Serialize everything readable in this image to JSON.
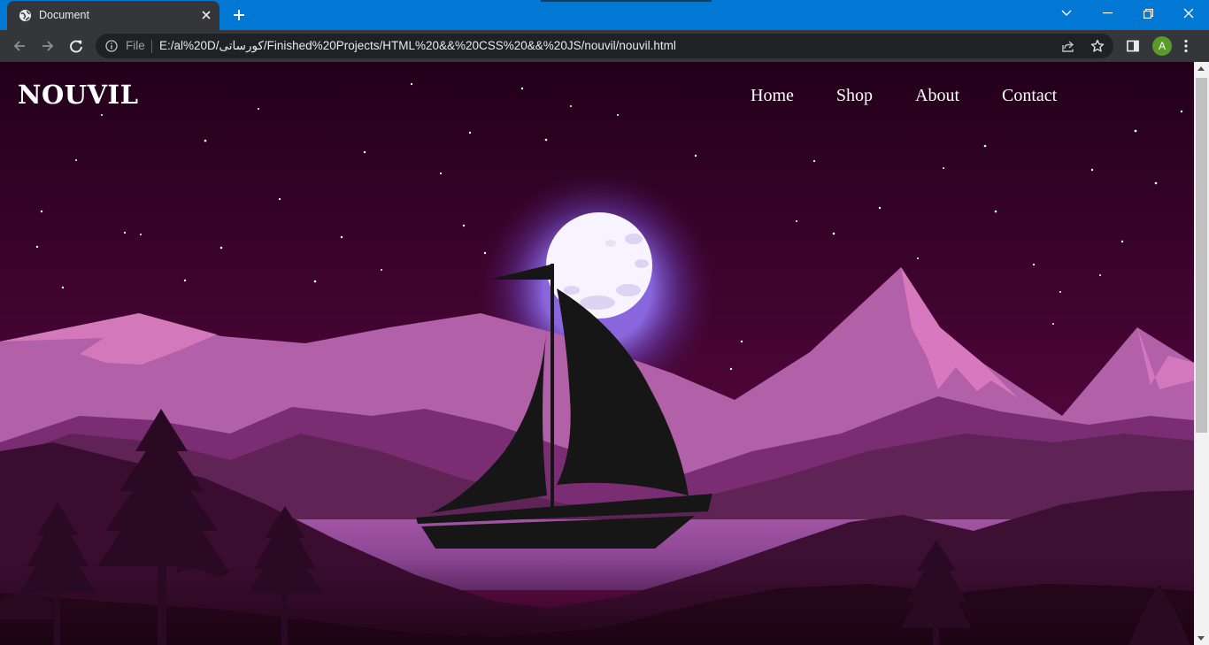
{
  "browser": {
    "tab": {
      "title": "Document",
      "icon": "globe-icon"
    },
    "controls": {
      "tab_search_icon": "chevron-down-icon",
      "minimize_icon": "minimize-icon",
      "restore_icon": "restore-icon",
      "close_icon": "close-icon"
    },
    "address": {
      "scheme_label": "File",
      "url": "E:/al%20D/کورساتی/Finished%20Projects/HTML%20&&%20CSS%20&&%20JS/nouvil/nouvil.html"
    },
    "profile_initial": "A",
    "accent_color": "#0078d4"
  },
  "page": {
    "brand": "NOUVIL",
    "nav": [
      {
        "label": "Home"
      },
      {
        "label": "Shop"
      },
      {
        "label": "About"
      },
      {
        "label": "Contact"
      }
    ],
    "colors": {
      "sky_top": "#24001a",
      "sky_bottom": "#6b0c4c",
      "mountain": "#b060a6",
      "boat": "#161616",
      "moon": "#f6f2ff"
    }
  }
}
